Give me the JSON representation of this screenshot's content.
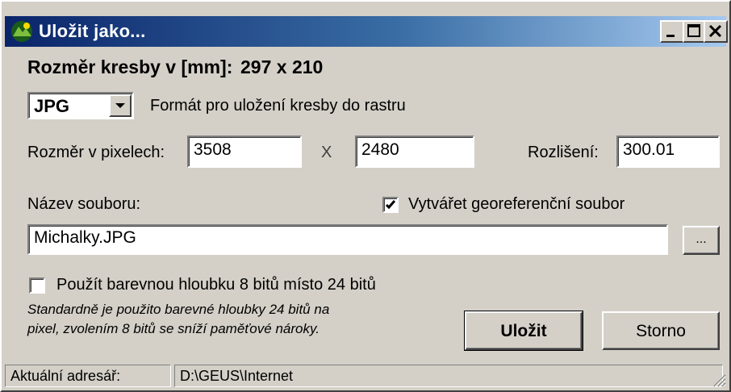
{
  "window": {
    "title": "Uložit jako...",
    "controls": {
      "minimize": "_",
      "maximize": "□",
      "close": "×"
    }
  },
  "drawing_size": {
    "label": "Rozměr kresby v [mm]:",
    "value": "297 x 210"
  },
  "format": {
    "selected": "JPG",
    "description": "Formát pro uložení kresby do rastru"
  },
  "pixels": {
    "label": "Rozměr v pixelech:",
    "width": "3508",
    "separator": "X",
    "height": "2480",
    "resolution_label": "Rozlišení:",
    "resolution": "300.01"
  },
  "filename": {
    "label": "Název souboru:",
    "value": "Michalky.JPG",
    "browse_label": "..."
  },
  "georef": {
    "label": "Vytvářet georeferenční soubor",
    "checked": true
  },
  "color_depth": {
    "label": "Použít barevnou hloubku 8 bitů místo 24 bitů",
    "checked": false
  },
  "note": {
    "line1": "Standardně je použito barevné hloubky 24 bitů na",
    "line2": "pixel, zvolením 8 bitů se sníží paměťové nároky."
  },
  "buttons": {
    "save": "Uložit",
    "cancel": "Storno"
  },
  "status": {
    "label": "Aktuální adresář:",
    "path": "D:\\GEUS\\Internet"
  }
}
